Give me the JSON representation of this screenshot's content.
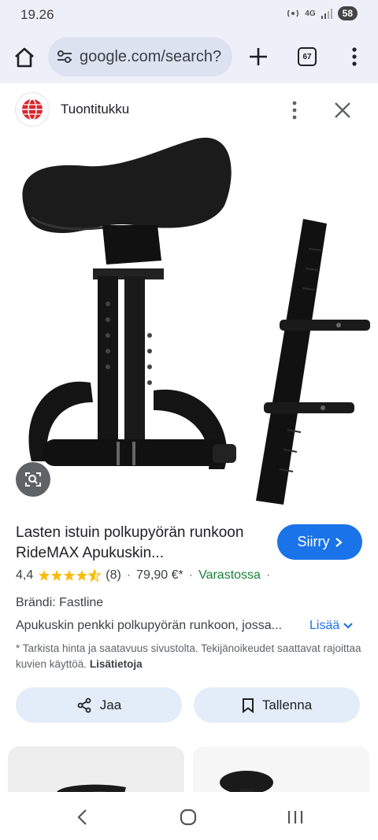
{
  "status_bar": {
    "time": "19.26",
    "network": "4G",
    "battery": "58"
  },
  "browser": {
    "url": "google.com/search?",
    "tab_count": "67"
  },
  "source": {
    "name": "Tuontitukku"
  },
  "product": {
    "title": "Lasten istuin polkupyörän runkoon RideMAX Apukuskin...",
    "go_label": "Siirry",
    "rating": "4,4",
    "rating_value": 4.4,
    "reviews": "(8)",
    "price": "79,90 €*",
    "availability": "Varastossa",
    "brand": "Brändi: Fastline",
    "description": "Apukuskin penkki polkupyörän runkoon, jossa...",
    "more_label": "Lisää",
    "note": "* Tarkista hinta ja saatavuus sivustolta. Tekijänoikeudet saattavat rajoittaa kuvien käyttöä.",
    "note_link": "Lisätietoja"
  },
  "actions": {
    "share_label": "Jaa",
    "save_label": "Tallenna"
  },
  "colors": {
    "accent": "#1a73e8",
    "stock_green": "#188038",
    "star": "#fbbc04"
  }
}
